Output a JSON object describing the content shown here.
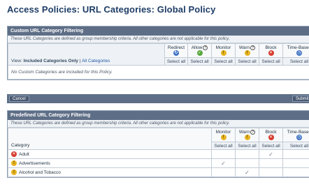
{
  "page_title": "Access Policies: URL Categories: Global Policy",
  "custom": {
    "header": "Custom URL Category Filtering",
    "note": "These URL Categories are defined as group membership criteria. All other categories are not applicable for this policy.",
    "columns": [
      {
        "label": "Redirect",
        "icon": "redirect-icon",
        "glyph": "↻",
        "cls": "ic-redirect",
        "help": false
      },
      {
        "label": "Allow",
        "icon": "allow-icon",
        "glyph": "✓",
        "cls": "ic-allow",
        "help": true
      },
      {
        "label": "Monitor",
        "icon": "monitor-icon",
        "glyph": "!",
        "cls": "ic-monitor",
        "help": false
      },
      {
        "label": "Warn",
        "icon": "warn-icon",
        "glyph": "!",
        "cls": "ic-warn",
        "help": true
      },
      {
        "label": "Block",
        "icon": "block-icon",
        "glyph": "✕",
        "cls": "ic-block",
        "help": false
      },
      {
        "label": "Time-Based",
        "icon": "time-based-icon",
        "glyph": "◷",
        "cls": "ic-time",
        "help": false
      }
    ],
    "view_label": "View:",
    "view_current": "Included Categories Only",
    "view_separator": "|",
    "view_link": "All Categories",
    "select_all": "Select all",
    "empty_message": "No Custom Categories are included for this Policy."
  },
  "buttons": {
    "cancel": "Cancel",
    "submit": "Submit"
  },
  "predefined": {
    "header": "Predefined URL Category Filtering",
    "note": "These URL Categories are defined as group membership criteria. All other categories are not applicable for this policy.",
    "category_header": "Category",
    "select_all": "Select all",
    "columns": [
      {
        "label": "Monitor",
        "icon": "monitor-icon",
        "glyph": "!",
        "cls": "ic-monitor",
        "help": false
      },
      {
        "label": "Warn",
        "icon": "warn-icon",
        "glyph": "!",
        "cls": "ic-warn",
        "help": true
      },
      {
        "label": "Block",
        "icon": "block-icon",
        "glyph": "✕",
        "cls": "ic-block",
        "help": false
      },
      {
        "label": "Time-Based",
        "icon": "time-based-icon",
        "glyph": "◷",
        "cls": "ic-time",
        "help": false
      }
    ],
    "rows": [
      {
        "name": "Adult",
        "icon": "block-icon",
        "glyph": "✕",
        "cls": "ic-block",
        "selected": "Block"
      },
      {
        "name": "Advertisements",
        "icon": "monitor-icon",
        "glyph": "!",
        "cls": "ic-monitor",
        "selected": "Monitor"
      },
      {
        "name": "Alcohol and Tobacco",
        "icon": "warn-icon",
        "glyph": "!",
        "cls": "ic-warn",
        "selected": "Warn"
      }
    ]
  },
  "help_glyph": "?",
  "check_glyph": "✓"
}
